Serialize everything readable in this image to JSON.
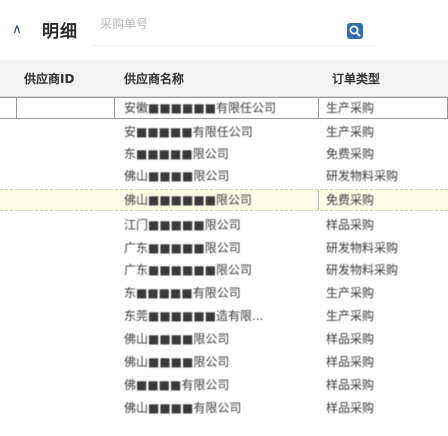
{
  "section": {
    "title": "明细",
    "search_placeholder": "采购单号"
  },
  "table": {
    "columns": [
      "供应商ID",
      "供应商名称",
      "订单类型"
    ],
    "rows": [
      {
        "supplier": "安徽■■■■■■有限任公司",
        "type": "生产采购"
      },
      {
        "supplier": "安■■■■■有限任公司",
        "type": "生产采购"
      },
      {
        "supplier": "东■■■■■限公司",
        "type": "免费采购"
      },
      {
        "supplier": "佛山■■■■限公司",
        "type": "研发物料采购"
      },
      {
        "supplier": "佛山■■■■■■限公司",
        "type": "免费采购"
      },
      {
        "supplier": "江门■■■■■限公司",
        "type": "样品采购"
      },
      {
        "supplier": "广东■■■■■限公司",
        "type": "研发物料采购"
      },
      {
        "supplier": "广东■■■■■■限公司",
        "type": "研发物料采购"
      },
      {
        "supplier": "东■■■■■有限公司",
        "type": "生产采购"
      },
      {
        "supplier": "东莞■■■■■■造有限...",
        "type": "生产采购"
      },
      {
        "supplier": "佛山■■■■限公司",
        "type": "样品采购"
      },
      {
        "supplier": "佛山■■■■限公司",
        "type": "样品采购"
      },
      {
        "supplier": "佛■■■■有限公司",
        "type": "样品采购"
      },
      {
        "supplier": "佛山■■■■有限公司",
        "type": "样品采购"
      }
    ]
  }
}
